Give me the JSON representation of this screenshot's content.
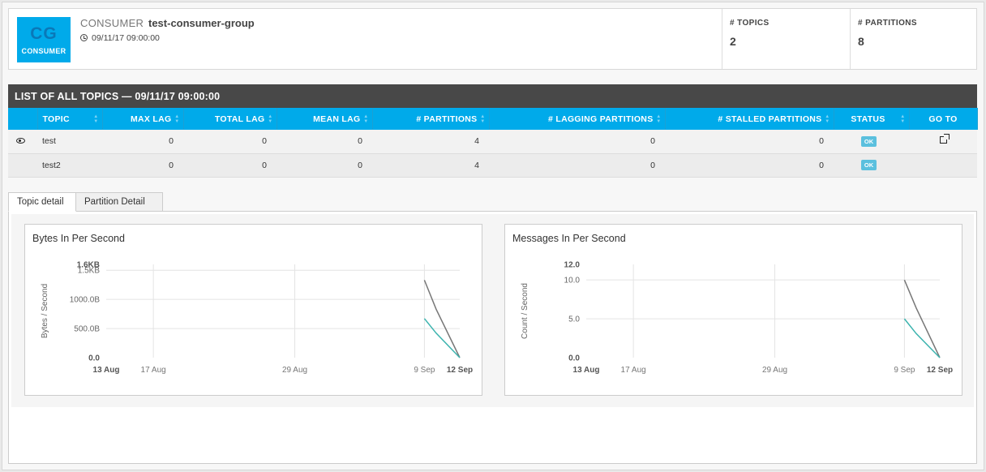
{
  "consumer": {
    "badge_initials": "CG",
    "badge_label": "CONSUMER",
    "kind_label": "CONSUMER",
    "name": "test-consumer-group",
    "timestamp": "09/11/17 09:00:00",
    "stats": [
      {
        "label": "# TOPICS",
        "value": "2"
      },
      {
        "label": "# PARTITIONS",
        "value": "8"
      }
    ]
  },
  "topics_table": {
    "title": "LIST OF ALL TOPICS — 09/11/17 09:00:00",
    "columns": [
      "TOPIC",
      "MAX LAG",
      "TOTAL LAG",
      "MEAN LAG",
      "# PARTITIONS",
      "# LAGGING PARTITIONS",
      "# STALLED PARTITIONS",
      "STATUS",
      "GO TO"
    ],
    "rows": [
      {
        "topic": "test",
        "max_lag": "0",
        "total_lag": "0",
        "mean_lag": "0",
        "partitions": "4",
        "lagging": "0",
        "stalled": "0",
        "status": "OK",
        "view_icon": "eye-icon",
        "goto_icon": "external-link-icon"
      },
      {
        "topic": "test2",
        "max_lag": "0",
        "total_lag": "0",
        "mean_lag": "0",
        "partitions": "4",
        "lagging": "0",
        "stalled": "0",
        "status": "OK"
      }
    ]
  },
  "tabs": [
    {
      "label": "Topic detail",
      "active": true
    },
    {
      "label": "Partition Detail",
      "active": false
    }
  ],
  "colors": {
    "accent": "#00aaea",
    "header_bar": "#484848",
    "status_ok": "#5bc0de",
    "series_dark": "#777777",
    "series_teal": "#3bb3ae"
  },
  "chart_data": [
    {
      "type": "line",
      "title": "Bytes In Per Second",
      "ylabel": "Bytes / Second",
      "xlabel": "",
      "x_ticks": [
        "13 Aug",
        "17 Aug",
        "29 Aug",
        "9 Sep",
        "12 Sep"
      ],
      "x_bold_ticks": [
        "13 Aug",
        "12 Sep"
      ],
      "y_ticks": [
        "0.0",
        "500.0B",
        "1000.0B",
        "1.5KB",
        "1.6KB"
      ],
      "y_bold_ticks": [
        "0.0",
        "1.6KB"
      ],
      "y_tick_values": [
        0,
        500,
        1000,
        1500,
        1600
      ],
      "ylim": [
        0,
        1600
      ],
      "x_domain": [
        "2017-08-13",
        "2017-09-12"
      ],
      "grid": true,
      "series": [
        {
          "x": [
            "2017-09-09",
            "2017-09-10",
            "2017-09-12"
          ],
          "values": [
            1330,
            830,
            0
          ],
          "color": "#777777"
        },
        {
          "x": [
            "2017-09-09",
            "2017-09-10",
            "2017-09-12"
          ],
          "values": [
            670,
            420,
            0
          ],
          "color": "#3bb3ae"
        }
      ]
    },
    {
      "type": "line",
      "title": "Messages In Per Second",
      "ylabel": "Count / Second",
      "xlabel": "",
      "x_ticks": [
        "13 Aug",
        "17 Aug",
        "29 Aug",
        "9 Sep",
        "12 Sep"
      ],
      "x_bold_ticks": [
        "13 Aug",
        "12 Sep"
      ],
      "y_ticks": [
        "0.0",
        "5.0",
        "10.0",
        "12.0"
      ],
      "y_bold_ticks": [
        "0.0",
        "12.0"
      ],
      "y_tick_values": [
        0,
        5,
        10,
        12
      ],
      "ylim": [
        0,
        12
      ],
      "x_domain": [
        "2017-08-13",
        "2017-09-12"
      ],
      "grid": true,
      "series": [
        {
          "x": [
            "2017-09-09",
            "2017-09-10",
            "2017-09-12"
          ],
          "values": [
            10,
            6.4,
            0
          ],
          "color": "#777777"
        },
        {
          "x": [
            "2017-09-09",
            "2017-09-10",
            "2017-09-12"
          ],
          "values": [
            5,
            3.1,
            0
          ],
          "color": "#3bb3ae"
        }
      ]
    }
  ]
}
